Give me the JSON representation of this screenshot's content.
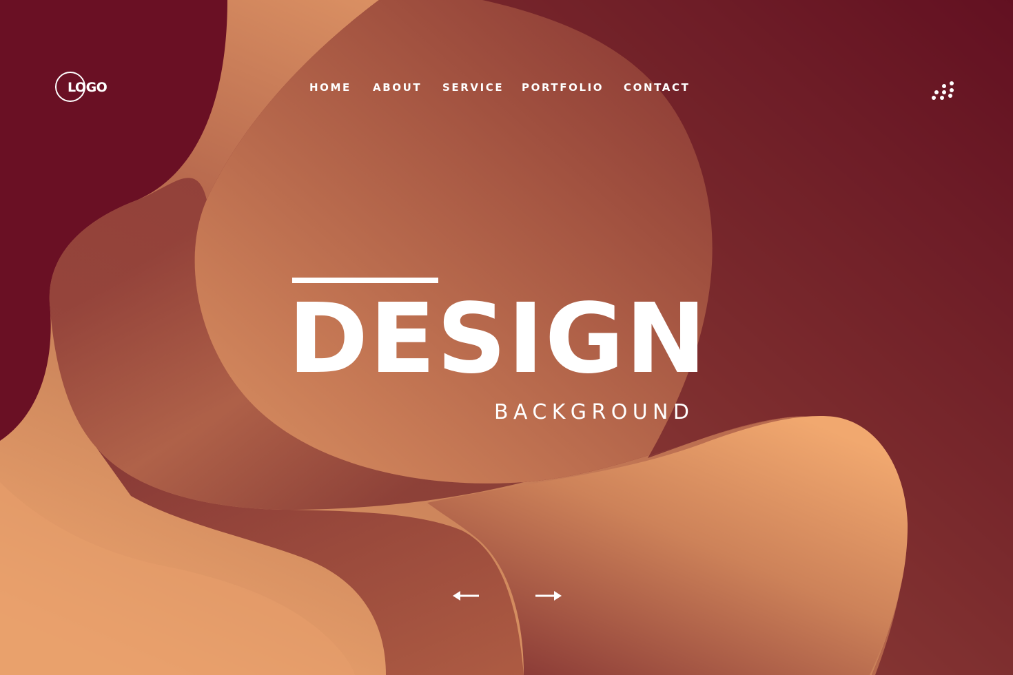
{
  "header": {
    "logo_text": "LOGO",
    "nav": [
      {
        "label": "HOME"
      },
      {
        "label": "ABOUT"
      },
      {
        "label": "SERVICE"
      },
      {
        "label": "PORTFOLIO"
      },
      {
        "label": "CONTACT"
      }
    ],
    "menu_icon": "dots-grid-icon"
  },
  "hero": {
    "title": "DESIGN",
    "subtitle": "BACKGROUND"
  },
  "carousel": {
    "prev_icon": "arrow-left-icon",
    "next_icon": "arrow-right-icon"
  },
  "colors": {
    "dark_maroon": "#5e0a1e",
    "mid_rust": "#a24e3c",
    "peach": "#f0a66e",
    "text": "#ffffff"
  }
}
